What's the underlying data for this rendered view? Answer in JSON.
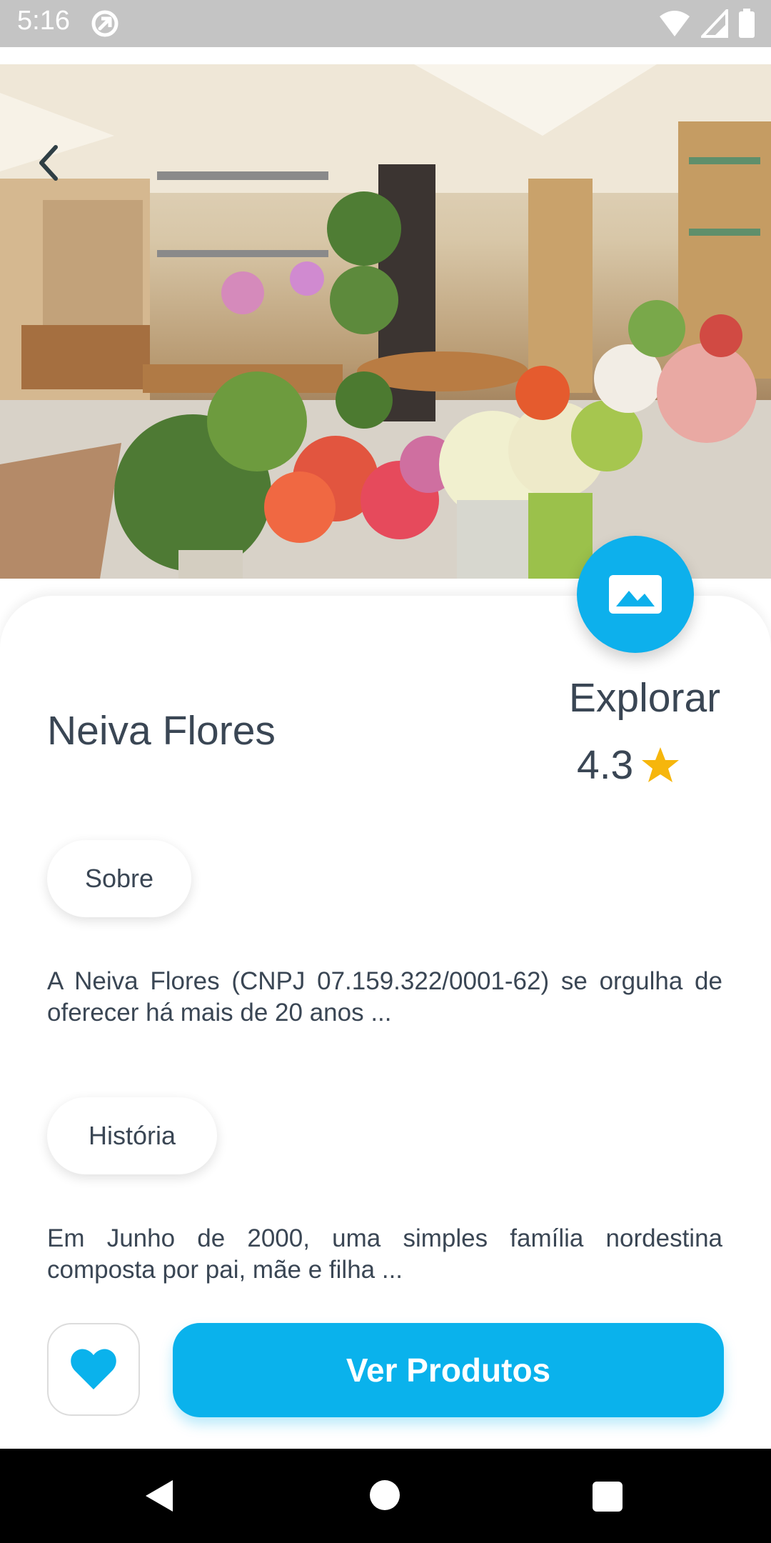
{
  "status_bar": {
    "time": "5:16",
    "icons": [
      "sync-icon",
      "wifi-icon",
      "cell-signal-icon",
      "battery-icon"
    ]
  },
  "hero": {
    "image": "flower-shop-photo",
    "back_icon": "chevron-left-icon"
  },
  "explore": {
    "icon": "image-icon",
    "label": "Explorar",
    "rating": "4.3",
    "rating_icon": "star-icon"
  },
  "store": {
    "name": "Neiva Flores"
  },
  "sections": [
    {
      "chip": "Sobre",
      "text": "A Neiva Flores (CNPJ 07.159.322/0001-62) se orgulha de oferecer há mais de 20 anos ..."
    },
    {
      "chip": "História",
      "text": "Em Junho de 2000, uma simples família nordestina composta por pai, mãe e filha ..."
    }
  ],
  "actions": {
    "favorite_icon": "heart-icon",
    "cta_label": "Ver Produtos"
  },
  "colors": {
    "accent": "#0DB0EC",
    "star": "#F6B60C",
    "text": "#3A4654"
  },
  "nav_bar": {
    "icons": [
      "back-triangle-icon",
      "home-circle-icon",
      "recents-square-icon"
    ]
  }
}
